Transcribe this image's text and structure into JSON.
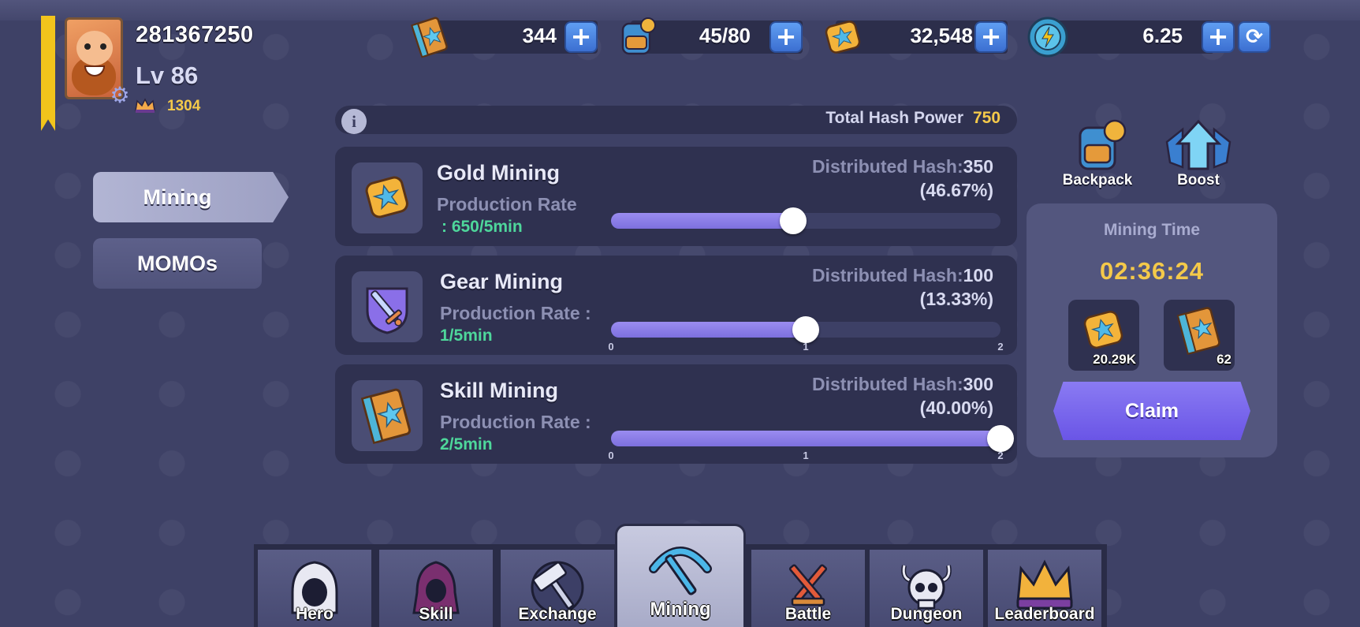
{
  "player": {
    "id": "281367250",
    "level": "Lv 86",
    "trophies": "1304"
  },
  "resources": {
    "skill_books": "344",
    "backpack": "45/80",
    "gold": "32,548",
    "energy": "6.25"
  },
  "side_tabs": {
    "mining": "Mining",
    "momos": "MOMOs"
  },
  "hash": {
    "label": "Total Hash Power",
    "value": "750"
  },
  "cards": [
    {
      "title": "Gold Mining",
      "rate_label": "Production Rate",
      "rate_value": ": 650/5min",
      "dist_label": "Distributed Hash:",
      "dist_value": "350",
      "dist_pct": "(46.67%)",
      "slider_fraction": 0.467,
      "ticks": []
    },
    {
      "title": "Gear Mining",
      "rate_label": "Production Rate :",
      "rate_value": "1/5min",
      "dist_label": "Distributed Hash:",
      "dist_value": "100",
      "dist_pct": "(13.33%)",
      "slider_fraction": 0.5,
      "ticks": [
        "0",
        "1",
        "2"
      ]
    },
    {
      "title": "Skill Mining",
      "rate_label": "Production Rate :",
      "rate_value": "2/5min",
      "dist_label": "Distributed Hash:",
      "dist_value": "300",
      "dist_pct": "(40.00%)",
      "slider_fraction": 1.0,
      "ticks": [
        "0",
        "1",
        "2"
      ]
    }
  ],
  "quick": {
    "backpack": "Backpack",
    "boost": "Boost"
  },
  "mining_panel": {
    "label": "Mining Time",
    "time": "02:36:24",
    "reward_gold": "20.29K",
    "reward_books": "62",
    "claim": "Claim"
  },
  "nav": {
    "hero": "Hero",
    "skill": "Skill",
    "exchange": "Exchange",
    "mining": "Mining",
    "battle": "Battle",
    "dungeon": "Dungeon",
    "leaderboard": "Leaderboard"
  },
  "colors": {
    "accent_yellow": "#f4c94a",
    "rate_green": "#4ed79b",
    "slider_purple": "#8a7df0",
    "button_blue": "#4f87e6"
  }
}
